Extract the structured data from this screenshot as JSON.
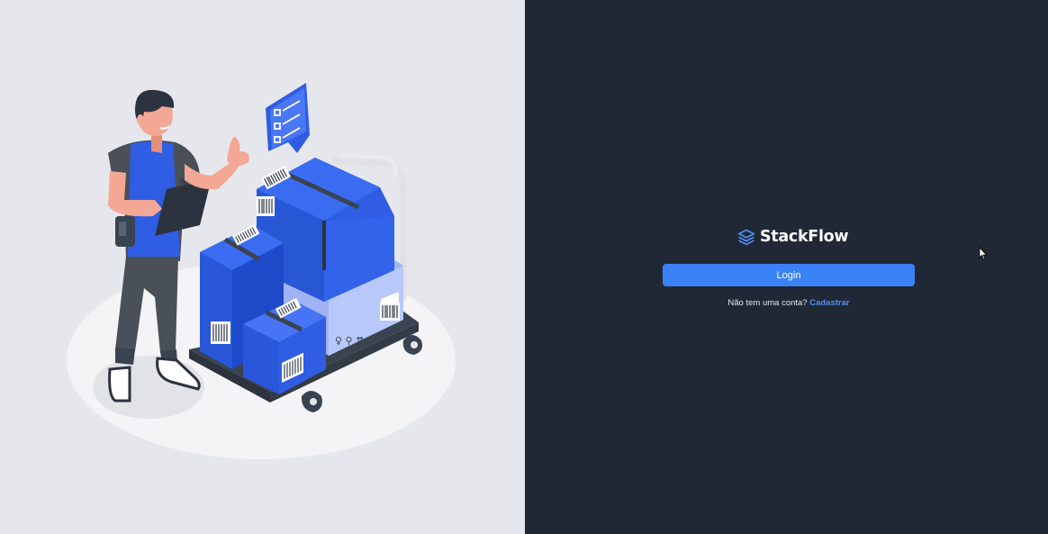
{
  "brand": {
    "name": "StackFlow",
    "icon": "layers-icon"
  },
  "login": {
    "button_label": "Login"
  },
  "signup": {
    "prompt": "Não tem uma conta?",
    "link_label": "Cadastrar"
  },
  "colors": {
    "left_background": "#e6e7ec",
    "right_background": "#202835",
    "accent": "#3b82f6",
    "link": "#4f8ff7"
  },
  "illustration": {
    "description_icon": "delivery-worker-with-boxes-illustration"
  }
}
